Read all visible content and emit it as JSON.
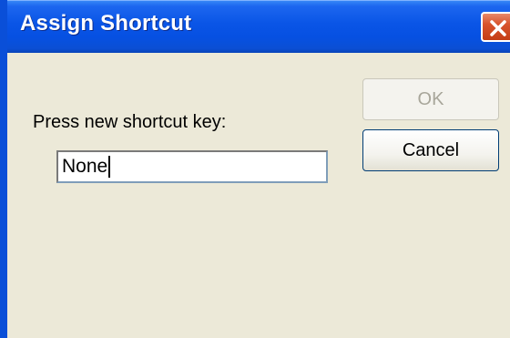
{
  "window": {
    "title": "Assign Shortcut"
  },
  "dialog": {
    "prompt_label": "Press new shortcut key:",
    "shortcut_value": "None",
    "ok_label": "OK",
    "ok_enabled": false,
    "cancel_label": "Cancel"
  },
  "icons": {
    "close": "close-icon"
  },
  "colors": {
    "titlebar": "#0a55e6",
    "dialog_background": "#ece9d8",
    "close_button": "#d8532c",
    "disabled_text": "#a8a69a"
  }
}
